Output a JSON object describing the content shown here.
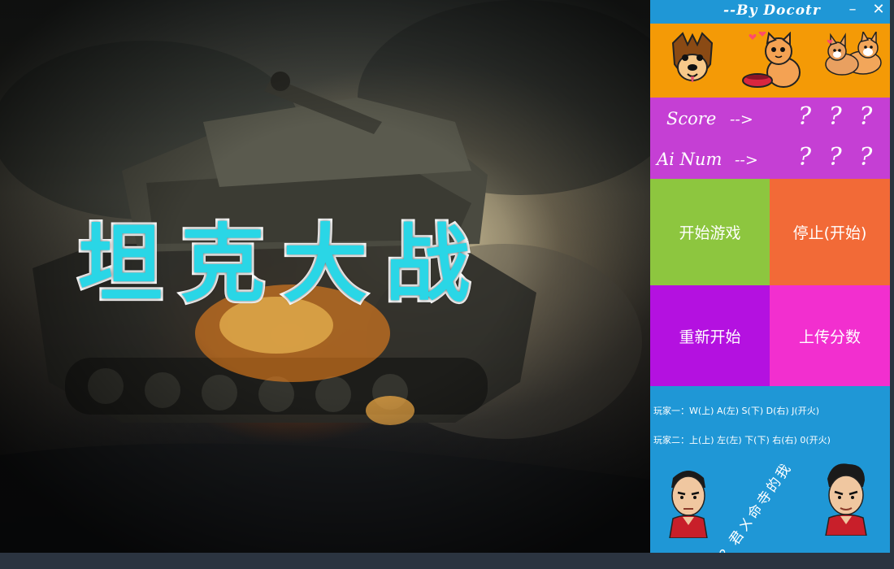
{
  "window": {
    "author": "--By  Docotr",
    "minimize_symbol": "–",
    "close_symbol": "✕"
  },
  "banner": {
    "title": "坦克大战"
  },
  "pets": {
    "icons": [
      "dog-face-icon",
      "cat-with-bowl-icon",
      "corgi-couple-icon"
    ]
  },
  "stats": {
    "score_label": "Score",
    "score_arrow": "-->",
    "score_value": "? ? ?",
    "ai_label": "Ai Num",
    "ai_arrow": "-->",
    "ai_value": "? ? ?"
  },
  "actions": {
    "start_label": "开始游戏",
    "stop_label": "停止(开始)",
    "restart_label": "重新开始",
    "upload_label": "上传分数"
  },
  "help": {
    "player1": "玩家一：W(上) A(左) S(下) D(右) J(开火)",
    "player2": "玩家二：上(上) 左(左) 下(下) 右(右) 0(开火)",
    "slogan": "？君ㄨ命寺的我"
  },
  "colors": {
    "panel_blue": "#1f97d6",
    "pets_orange": "#f49a06",
    "stats_purple": "#c53fd4",
    "start_green": "#8dc63f",
    "stop_orange": "#f26a37",
    "restart_purple": "#b411e0",
    "upload_pink": "#f22fcf",
    "title_cyan": "#2ad6e6"
  }
}
